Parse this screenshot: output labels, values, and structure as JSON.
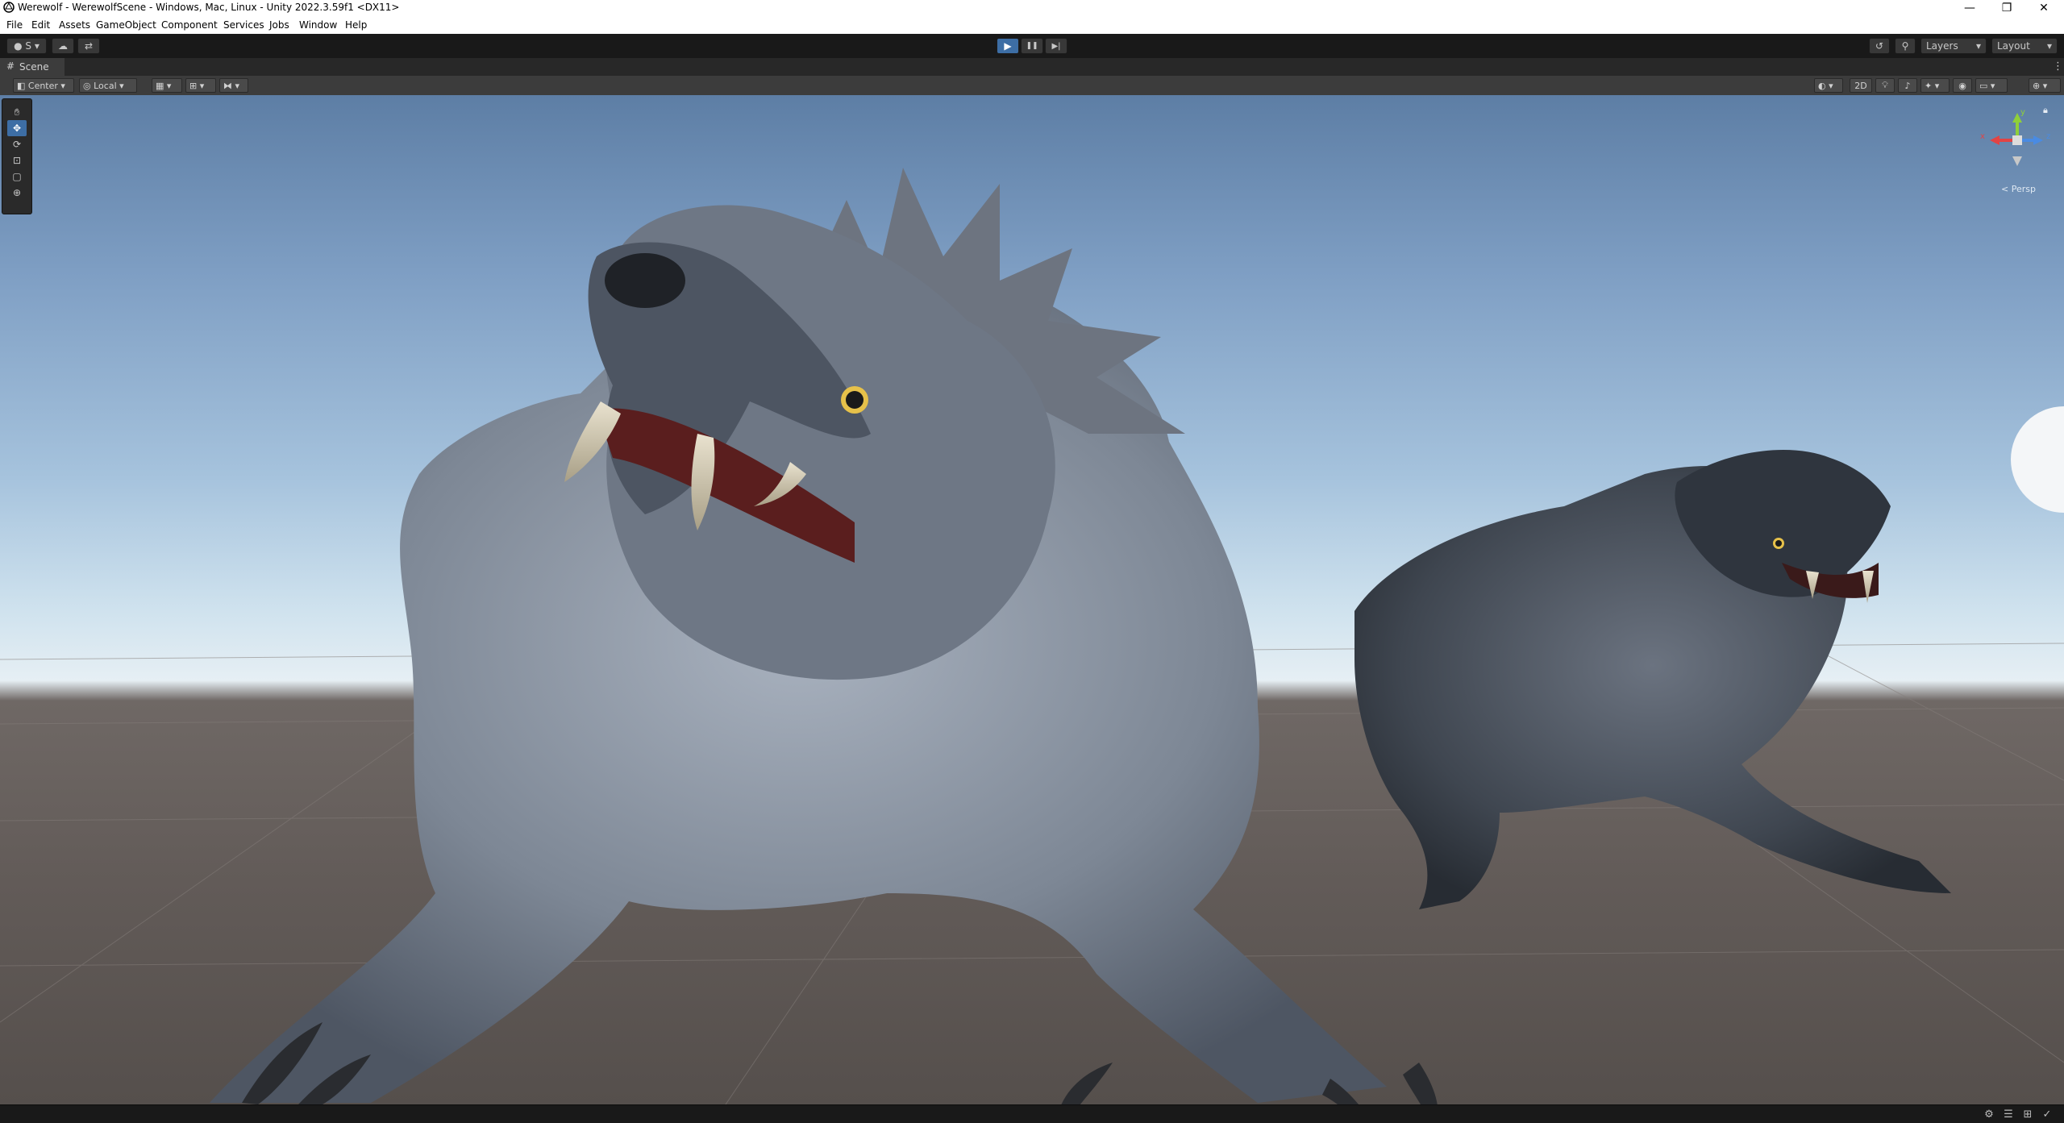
{
  "window": {
    "title": "Werewolf - WerewolfScene - Windows, Mac, Linux - Unity 2022.3.59f1 <DX11>",
    "minimize": "—",
    "maximize": "❐",
    "close": "✕"
  },
  "menu": [
    "File",
    "Edit",
    "Assets",
    "GameObject",
    "Component",
    "Services",
    "Jobs",
    "Window",
    "Help"
  ],
  "toolbar": {
    "account_label": "S",
    "play_icon": "▶",
    "pause_icon": "❚❚",
    "step_icon": "▶|",
    "layers_label": "Layers",
    "layout_label": "Layout",
    "history_icon": "↺",
    "search_icon": "⚲",
    "cloud_icon": "☁"
  },
  "scene_tab": {
    "label": "Scene",
    "more_icon": "⋮"
  },
  "scene_toolbar": {
    "pivot_label": "Center",
    "space_label": "Local",
    "mode_2d": "2D"
  },
  "gizmo": {
    "projection_label": "< Persp",
    "axis_x": "x",
    "axis_y": "y",
    "axis_z": "z"
  },
  "colors": {
    "accent": "#3d6ea5",
    "gizmo_x": "#e24444",
    "gizmo_y": "#8fcf3a",
    "gizmo_z": "#4a8be2"
  }
}
